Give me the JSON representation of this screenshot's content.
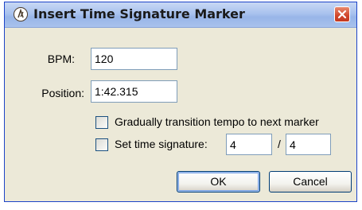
{
  "window": {
    "title": "Insert Time Signature Marker"
  },
  "fields": {
    "bpm": {
      "label": "BPM:",
      "value": "120"
    },
    "position": {
      "label": "Position:",
      "value": "1:42.315"
    }
  },
  "options": {
    "gradual": {
      "label": "Gradually transition tempo to next marker",
      "checked": false
    },
    "timesig": {
      "label": "Set time signature:",
      "checked": false,
      "numerator": "4",
      "separator": "/",
      "denominator": "4"
    }
  },
  "buttons": {
    "ok": "OK",
    "cancel": "Cancel"
  },
  "icons": {
    "app": "metronome-icon",
    "close": "close-icon"
  }
}
